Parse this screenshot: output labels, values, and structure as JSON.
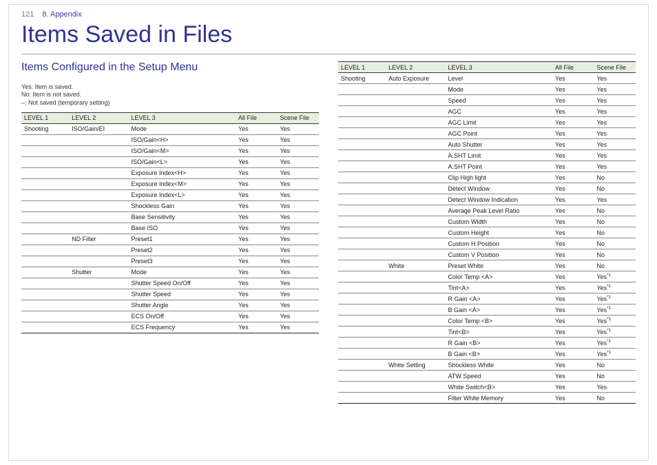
{
  "header": {
    "page_number": "121",
    "chapter": "8. Appendix"
  },
  "title": "Items Saved in Files",
  "subtitle": "Items Configured in the Setup Menu",
  "legend": {
    "l1": "Yes: Item is saved.",
    "l2": "No: Item is not saved.",
    "l3": "–: Not saved (temporary setting)"
  },
  "columns": {
    "c1": "LEVEL 1",
    "c2": "LEVEL 2",
    "c3": "LEVEL 3",
    "c4": "All File",
    "c5": "Scene File"
  },
  "left_rows": [
    {
      "l1": "Shooting",
      "l2": "ISO/Gain/EI",
      "l3": "Mode",
      "af": "Yes",
      "sf": "Yes"
    },
    {
      "l1": "",
      "l2": "",
      "l3": "ISO/Gain<H>",
      "af": "Yes",
      "sf": "Yes"
    },
    {
      "l1": "",
      "l2": "",
      "l3": "ISO/Gain<M>",
      "af": "Yes",
      "sf": "Yes"
    },
    {
      "l1": "",
      "l2": "",
      "l3": "ISO/Gain<L>",
      "af": "Yes",
      "sf": "Yes"
    },
    {
      "l1": "",
      "l2": "",
      "l3": "Exposure Index<H>",
      "af": "Yes",
      "sf": "Yes"
    },
    {
      "l1": "",
      "l2": "",
      "l3": "Exposure Index<M>",
      "af": "Yes",
      "sf": "Yes"
    },
    {
      "l1": "",
      "l2": "",
      "l3": "Exposure Index<L>",
      "af": "Yes",
      "sf": "Yes"
    },
    {
      "l1": "",
      "l2": "",
      "l3": "Shockless Gain",
      "af": "Yes",
      "sf": "Yes"
    },
    {
      "l1": "",
      "l2": "",
      "l3": "Base Sensitivity",
      "af": "Yes",
      "sf": "Yes"
    },
    {
      "l1": "",
      "l2": "",
      "l3": "Base ISO",
      "af": "Yes",
      "sf": "Yes"
    },
    {
      "l1": "",
      "l2": "ND Filter",
      "l3": "Preset1",
      "af": "Yes",
      "sf": "Yes"
    },
    {
      "l1": "",
      "l2": "",
      "l3": "Preset2",
      "af": "Yes",
      "sf": "Yes"
    },
    {
      "l1": "",
      "l2": "",
      "l3": "Preset3",
      "af": "Yes",
      "sf": "Yes"
    },
    {
      "l1": "",
      "l2": "Shutter",
      "l3": "Mode",
      "af": "Yes",
      "sf": "Yes"
    },
    {
      "l1": "",
      "l2": "",
      "l3": "Shutter Speed On/Off",
      "af": "Yes",
      "sf": "Yes"
    },
    {
      "l1": "",
      "l2": "",
      "l3": "Shutter Speed",
      "af": "Yes",
      "sf": "Yes"
    },
    {
      "l1": "",
      "l2": "",
      "l3": "Shutter Angle",
      "af": "Yes",
      "sf": "Yes"
    },
    {
      "l1": "",
      "l2": "",
      "l3": "ECS On/Off",
      "af": "Yes",
      "sf": "Yes"
    },
    {
      "l1": "",
      "l2": "",
      "l3": "ECS Frequency",
      "af": "Yes",
      "sf": "Yes",
      "last": true
    }
  ],
  "right_rows": [
    {
      "l1": "Shooting",
      "l2": "Auto Exposure",
      "l3": "Level",
      "af": "Yes",
      "sf": "Yes"
    },
    {
      "l1": "",
      "l2": "",
      "l3": "Mode",
      "af": "Yes",
      "sf": "Yes"
    },
    {
      "l1": "",
      "l2": "",
      "l3": "Speed",
      "af": "Yes",
      "sf": "Yes"
    },
    {
      "l1": "",
      "l2": "",
      "l3": "AGC",
      "af": "Yes",
      "sf": "Yes"
    },
    {
      "l1": "",
      "l2": "",
      "l3": "AGC Limit",
      "af": "Yes",
      "sf": "Yes"
    },
    {
      "l1": "",
      "l2": "",
      "l3": "AGC Point",
      "af": "Yes",
      "sf": "Yes"
    },
    {
      "l1": "",
      "l2": "",
      "l3": "Auto Shutter",
      "af": "Yes",
      "sf": "Yes"
    },
    {
      "l1": "",
      "l2": "",
      "l3": "A.SHT Limit",
      "af": "Yes",
      "sf": "Yes"
    },
    {
      "l1": "",
      "l2": "",
      "l3": "A.SHT Point",
      "af": "Yes",
      "sf": "Yes"
    },
    {
      "l1": "",
      "l2": "",
      "l3": "Clip High light",
      "af": "Yes",
      "sf": "No"
    },
    {
      "l1": "",
      "l2": "",
      "l3": "Detect Window",
      "af": "Yes",
      "sf": "No"
    },
    {
      "l1": "",
      "l2": "",
      "l3": "Detect Window Indication",
      "af": "Yes",
      "sf": "Yes"
    },
    {
      "l1": "",
      "l2": "",
      "l3": "Average Peak Level Ratio",
      "af": "Yes",
      "sf": "No"
    },
    {
      "l1": "",
      "l2": "",
      "l3": "Custom Width",
      "af": "Yes",
      "sf": "No"
    },
    {
      "l1": "",
      "l2": "",
      "l3": "Custom Height",
      "af": "Yes",
      "sf": "No"
    },
    {
      "l1": "",
      "l2": "",
      "l3": "Custom H Position",
      "af": "Yes",
      "sf": "No"
    },
    {
      "l1": "",
      "l2": "",
      "l3": "Custom V Position",
      "af": "Yes",
      "sf": "No"
    },
    {
      "l1": "",
      "l2": "White",
      "l3": "Preset White",
      "af": "Yes",
      "sf": "No"
    },
    {
      "l1": "",
      "l2": "",
      "l3": "Color Temp <A>",
      "af": "Yes",
      "sf": "Yes",
      "star": true
    },
    {
      "l1": "",
      "l2": "",
      "l3": "Tint<A>",
      "af": "Yes",
      "sf": "Yes",
      "star": true
    },
    {
      "l1": "",
      "l2": "",
      "l3": "R Gain <A>",
      "af": "Yes",
      "sf": "Yes",
      "star": true
    },
    {
      "l1": "",
      "l2": "",
      "l3": "B Gain <A>",
      "af": "Yes",
      "sf": "Yes",
      "star": true
    },
    {
      "l1": "",
      "l2": "",
      "l3": "Color Temp <B>",
      "af": "Yes",
      "sf": "Yes",
      "star": true
    },
    {
      "l1": "",
      "l2": "",
      "l3": "Tint<B>",
      "af": "Yes",
      "sf": "Yes",
      "star": true
    },
    {
      "l1": "",
      "l2": "",
      "l3": "R Gain <B>",
      "af": "Yes",
      "sf": "Yes",
      "star": true
    },
    {
      "l1": "",
      "l2": "",
      "l3": "B Gain <B>",
      "af": "Yes",
      "sf": "Yes",
      "star": true
    },
    {
      "l1": "",
      "l2": "White Setting",
      "l3": "Shockless White",
      "af": "Yes",
      "sf": "No"
    },
    {
      "l1": "",
      "l2": "",
      "l3": "ATW Speed",
      "af": "Yes",
      "sf": "No"
    },
    {
      "l1": "",
      "l2": "",
      "l3": "White Switch<B>",
      "af": "Yes",
      "sf": "Yes"
    },
    {
      "l1": "",
      "l2": "",
      "l3": "Filter White Memory",
      "af": "Yes",
      "sf": "No",
      "last": true
    }
  ]
}
